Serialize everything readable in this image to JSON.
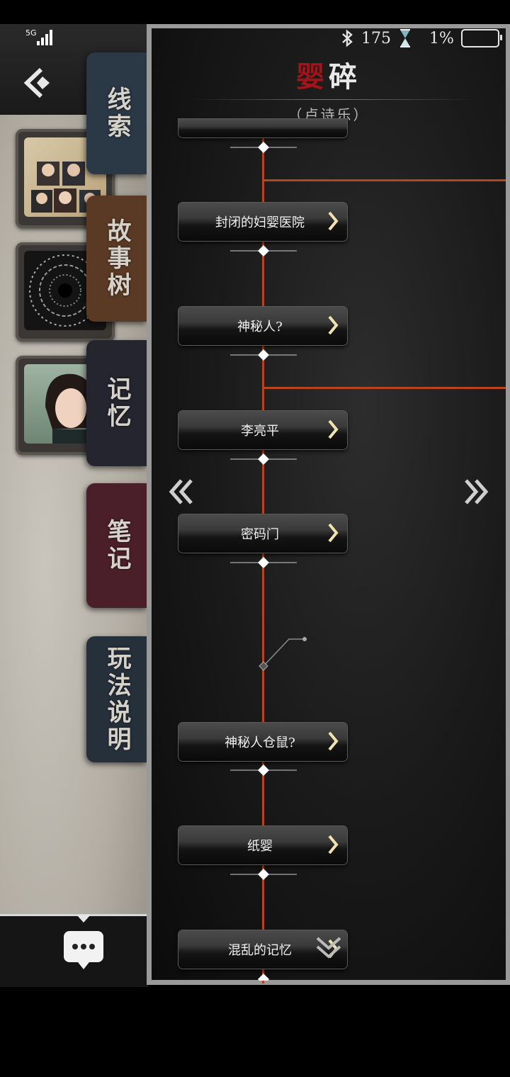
{
  "status_bar": {
    "network": "5G",
    "time_or_count": "175",
    "battery": "1%"
  },
  "header": {
    "title_part1": "婴",
    "title_part2": "碎",
    "subtitle": "（卢诗乐）"
  },
  "side_tabs": [
    {
      "label": "线索",
      "color": "#2b3845"
    },
    {
      "label": "故事树",
      "color": "#5a3a24"
    },
    {
      "label": "记忆",
      "color": "#24252f"
    },
    {
      "label": "笔记",
      "color": "#4a1f2a"
    },
    {
      "label": "玩法说明",
      "color": "#26303b"
    }
  ],
  "story_nodes": [
    {
      "label": "封闭的妇婴医院"
    },
    {
      "label": "神秘人?"
    },
    {
      "label": "李亮平"
    },
    {
      "label": "密码门"
    },
    {
      "label": "神秘人仓鼠?"
    },
    {
      "label": "纸婴"
    },
    {
      "label": "混乱的记忆"
    }
  ],
  "colors": {
    "accent_red": "#a3141a",
    "branch_line": "#b5451b"
  }
}
